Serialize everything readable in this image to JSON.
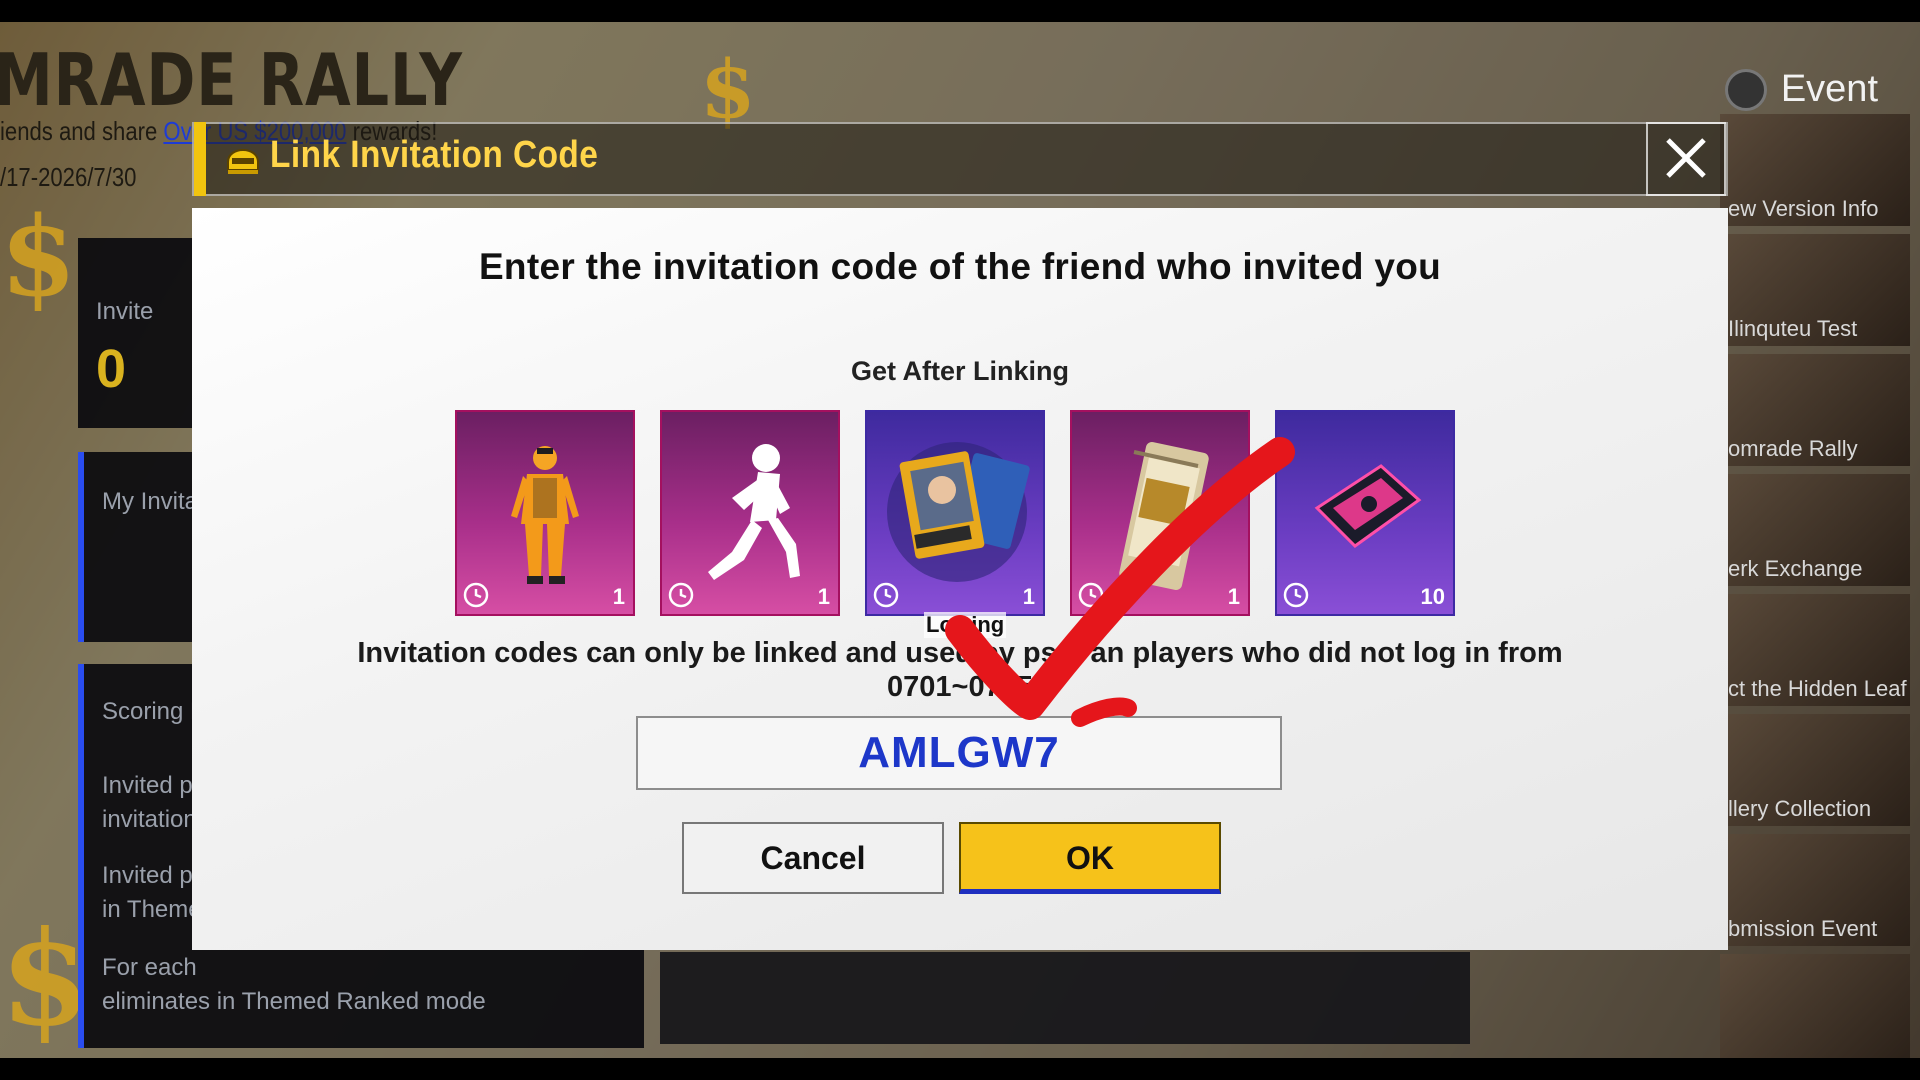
{
  "background": {
    "event_title": "MRADE RALLY",
    "subtitle_prefix": "iends and share ",
    "subtitle_link": "Over US $200,000",
    "subtitle_suffix": " rewards!",
    "date_range": "/17-2026/7/30",
    "event_button": "Event",
    "left_panels": {
      "invite_label": "Invite",
      "invite_value": "0",
      "my_invites_label": "My Invita",
      "scoring_label": "Scoring R",
      "rule_1_line1": "Invited pl",
      "rule_1_line2": "invitation",
      "rule_2_line1": "Invited pl",
      "rule_2_line2": "in Themed",
      "rule_3_line1": "For each",
      "rule_3_line2": "eliminates in Themed Ranked mode"
    },
    "right_menu": [
      "ew Version Info",
      "Ilinquteu Test",
      "omrade Rally",
      "erk Exchange",
      "ct the Hidden Leaf",
      "llery Collection",
      "bmission Event",
      ""
    ]
  },
  "dialog": {
    "title": "Link Invitation Code",
    "prompt": "Enter the invitation code of the friend who invited you",
    "rewards_label": "Get After Linking",
    "rewards": [
      {
        "name": "orange-outfit",
        "qty": "1",
        "theme": "pink"
      },
      {
        "name": "emote-pose",
        "qty": "1",
        "theme": "pink"
      },
      {
        "name": "voice-card",
        "qty": "1",
        "theme": "purple"
      },
      {
        "name": "supply-pack",
        "qty": "1",
        "theme": "pink"
      },
      {
        "name": "ticket-voucher",
        "qty": "10",
        "theme": "purple"
      }
    ],
    "loading_text": "Loa ing",
    "notice_line1": "Invitation codes can only be linked and used by  ps        ti     an players who did not log in from",
    "notice_line2": "0701~0715",
    "code_value": "AMLGW7",
    "cancel_label": "Cancel",
    "ok_label": "OK"
  },
  "colors": {
    "accent_yellow": "#f6c21a",
    "title_yellow": "#ffd54a",
    "code_blue": "#1d37c9",
    "annotation_red": "#e5161b"
  }
}
